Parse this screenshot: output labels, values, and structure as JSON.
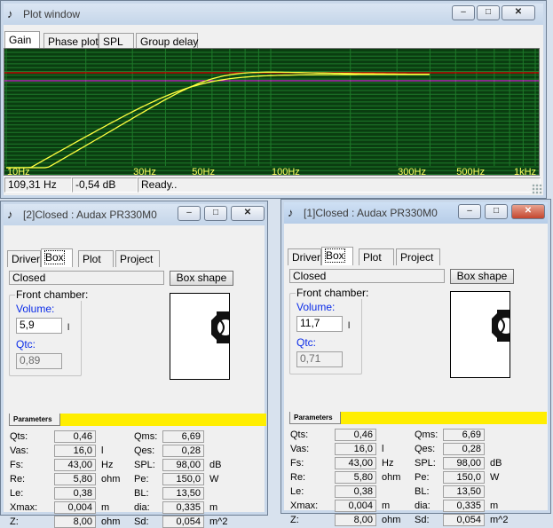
{
  "plot_window": {
    "title": "Plot window",
    "tabs": [
      "Gain",
      "Phase plot",
      "SPL",
      "Group delay"
    ],
    "selected_tab": "Gain",
    "x_ticks": [
      "10Hz",
      "30Hz",
      "50Hz",
      "100Hz",
      "300Hz",
      "500Hz",
      "1kHz"
    ],
    "status": {
      "freq": "109,31 Hz",
      "gain": "-0,54 dB",
      "state": "Ready.."
    },
    "colors": {
      "background": "#0a3d10",
      "grid": "#1e7a2a",
      "curve": "#ffff40",
      "ref_red": "#e00000",
      "ref_magenta": "#ff20ff"
    }
  },
  "box_windows": [
    {
      "title": "[2]Closed : Audax PR330M0",
      "active": false,
      "tabs": [
        "Driver",
        "Box",
        "Plot",
        "Project"
      ],
      "selected_tab": "Box",
      "box_type": "Closed",
      "box_shape_button": "Box shape",
      "front_chamber_label": "Front chamber:",
      "volume_label": "Volume:",
      "volume_value": "5,9",
      "volume_unit": "l",
      "qtc_label": "Qtc:",
      "qtc_value": "0,89",
      "params_tab": "Parameters",
      "params_left": [
        {
          "label": "Qts:",
          "value": "0,46",
          "unit": ""
        },
        {
          "label": "Vas:",
          "value": "16,0",
          "unit": "l"
        },
        {
          "label": "Fs:",
          "value": "43,00",
          "unit": "Hz"
        },
        {
          "label": "Re:",
          "value": "5,80",
          "unit": "ohm"
        },
        {
          "label": "Le:",
          "value": "0,38",
          "unit": ""
        },
        {
          "label": "Xmax:",
          "value": "0,004",
          "unit": "m"
        },
        {
          "label": "Z:",
          "value": "8,00",
          "unit": "ohm"
        }
      ],
      "params_right": [
        {
          "label": "Qms:",
          "value": "6,69",
          "unit": ""
        },
        {
          "label": "Qes:",
          "value": "0,28",
          "unit": ""
        },
        {
          "label": "SPL:",
          "value": "98,00",
          "unit": "dB"
        },
        {
          "label": "Pe:",
          "value": "150,0",
          "unit": "W"
        },
        {
          "label": "BL:",
          "value": "13,50",
          "unit": ""
        },
        {
          "label": "dia:",
          "value": "0,335",
          "unit": "m"
        },
        {
          "label": "Sd:",
          "value": "0,054",
          "unit": "m^2"
        }
      ]
    },
    {
      "title": "[1]Closed : Audax PR330M0",
      "active": true,
      "tabs": [
        "Driver",
        "Box",
        "Plot",
        "Project"
      ],
      "selected_tab": "Box",
      "box_type": "Closed",
      "box_shape_button": "Box shape",
      "front_chamber_label": "Front chamber:",
      "volume_label": "Volume:",
      "volume_value": "11,7",
      "volume_unit": "l",
      "qtc_label": "Qtc:",
      "qtc_value": "0,71",
      "params_tab": "Parameters",
      "params_left": [
        {
          "label": "Qts:",
          "value": "0,46",
          "unit": ""
        },
        {
          "label": "Vas:",
          "value": "16,0",
          "unit": "l"
        },
        {
          "label": "Fs:",
          "value": "43,00",
          "unit": "Hz"
        },
        {
          "label": "Re:",
          "value": "5,80",
          "unit": "ohm"
        },
        {
          "label": "Le:",
          "value": "0,38",
          "unit": ""
        },
        {
          "label": "Xmax:",
          "value": "0,004",
          "unit": "m"
        },
        {
          "label": "Z:",
          "value": "8,00",
          "unit": "ohm"
        }
      ],
      "params_right": [
        {
          "label": "Qms:",
          "value": "6,69",
          "unit": ""
        },
        {
          "label": "Qes:",
          "value": "0,28",
          "unit": ""
        },
        {
          "label": "SPL:",
          "value": "98,00",
          "unit": "dB"
        },
        {
          "label": "Pe:",
          "value": "150,0",
          "unit": "W"
        },
        {
          "label": "BL:",
          "value": "13,50",
          "unit": ""
        },
        {
          "label": "dia:",
          "value": "0,335",
          "unit": "m"
        },
        {
          "label": "Sd:",
          "value": "0,054",
          "unit": "m^2"
        }
      ]
    }
  ]
}
